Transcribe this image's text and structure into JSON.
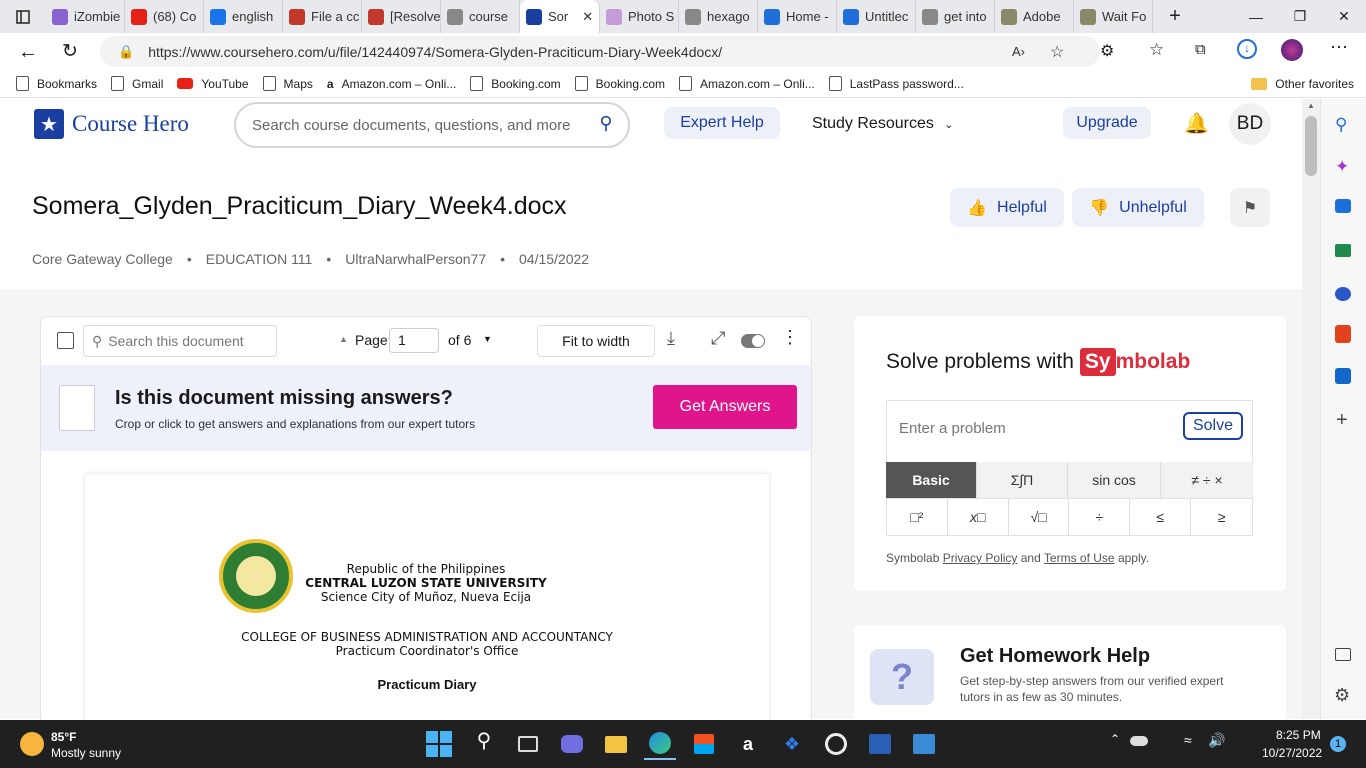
{
  "browser": {
    "tabs": [
      {
        "title": "iZombie",
        "color": "#8a63d2"
      },
      {
        "title": "(68) Co",
        "color": "#e62117"
      },
      {
        "title": "english",
        "color": "#1a73e8"
      },
      {
        "title": "File a cc",
        "color": "#c0392b"
      },
      {
        "title": "[Resolve",
        "color": "#c0392b"
      },
      {
        "title": "course",
        "color": "#888"
      },
      {
        "title": "Sor",
        "color": "#1b3fa0"
      },
      {
        "title": "Photo S",
        "color": "#c79ad9"
      },
      {
        "title": "hexago",
        "color": "#888"
      },
      {
        "title": "Home -",
        "color": "#1e6fd9"
      },
      {
        "title": "Untitlec",
        "color": "#1e6fd9"
      },
      {
        "title": "get into",
        "color": "#888"
      },
      {
        "title": "Adobe",
        "color": "#8a8a6a"
      },
      {
        "title": "Wait Fo",
        "color": "#8a8a6a"
      }
    ],
    "url": "https://www.coursehero.com/u/file/142440974/Somera-Glyden-Praciticum-Diary-Week4docx/",
    "bookmarks": [
      "Bookmarks",
      "Gmail",
      "YouTube",
      "Maps",
      "Amazon.com – Onli...",
      "Booking.com",
      "Booking.com",
      "Amazon.com – Onli...",
      "LastPass password..."
    ],
    "other_favorites": "Other favorites"
  },
  "site": {
    "logo_text": "Course Hero",
    "search_placeholder": "Search course documents, questions, and more",
    "expert_help": "Expert Help",
    "study_resources": "Study Resources",
    "upgrade": "Upgrade",
    "avatar": "BD"
  },
  "doc": {
    "title": "Somera_Glyden_Praciticum_Diary_Week4.docx",
    "helpful": "Helpful",
    "unhelpful": "Unhelpful",
    "meta": [
      "Core Gateway College",
      "EDUCATION 111",
      "UltraNarwhalPerson77",
      "04/15/2022"
    ],
    "search_placeholder": "Search this document",
    "page_label": "Page",
    "page_value": "1",
    "of_pages": "of 6",
    "fit": "Fit to width",
    "missing_title": "Is this document missing answers?",
    "missing_sub": "Crop or click to get answers and explanations from our expert tutors",
    "get_answers": "Get Answers",
    "content": {
      "line1": "Republic of the Philippines",
      "line2": "CENTRAL LUZON STATE UNIVERSITY",
      "line3": "Science City of Muñoz, Nueva Ecija",
      "line4": "COLLEGE OF BUSINESS ADMINISTRATION AND ACCOUNTANCY",
      "line5": "Practicum Coordinator's Office",
      "line6": "Practicum Diary"
    }
  },
  "symbolab": {
    "heading": "Solve problems with",
    "brand_sy": "Sy",
    "brand_rest": "mbolab",
    "placeholder": "Enter a problem",
    "solve": "Solve",
    "tabs": [
      "Basic",
      "Σ∫Π",
      "sin cos",
      "≠ ÷ ×"
    ],
    "keys": [
      "□²",
      "x□",
      "√□",
      "÷",
      "≤",
      "≥"
    ],
    "footer_prefix": "Symbolab",
    "privacy": "Privacy Policy",
    "and": "and",
    "terms": "Terms of Use",
    "apply": "apply."
  },
  "homework": {
    "title": "Get Homework Help",
    "sub": "Get step-by-step answers from our verified expert tutors in as few as 30 minutes."
  },
  "taskbar": {
    "temp": "85°F",
    "weather": "Mostly sunny",
    "time": "8:25 PM",
    "date": "10/27/2022",
    "notif": "1"
  },
  "colors": {
    "brand_blue": "#1b3fa0",
    "magenta": "#e0158b",
    "symbolab_red": "#dd2c3c"
  }
}
